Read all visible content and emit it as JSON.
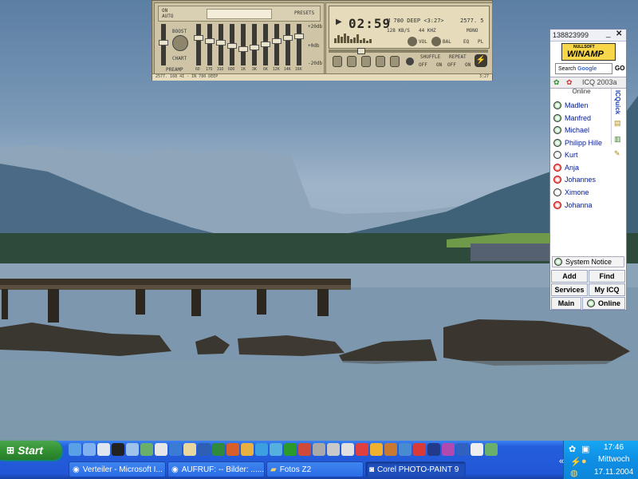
{
  "winamp": {
    "eq_labels": [
      "ON",
      "AUTO",
      "PRESETS",
      "PREAMP",
      "BOOST",
      "CHART",
      "60",
      "170",
      "310",
      "600",
      "1K",
      "3K",
      "6K",
      "12K",
      "14K",
      "16K",
      "+20db",
      "+0db",
      "-20db"
    ],
    "time": "02:59",
    "track": "M 780 DEEP <3:27>",
    "kbps": "128 KB/S",
    "khz": "44 KHZ",
    "mode": "MONO",
    "counter": "2577. 5",
    "vol_label": "VOL",
    "bal_label": "BAL",
    "eq_btn": "EQ",
    "pl_btn": "PL",
    "shuffle_label": "SHUFFLE",
    "repeat_label": "REPEAT",
    "off_label": "OFF",
    "on_label": "ON",
    "status_left": "2577. 168 4I - IN 780 DEEP",
    "status_right": "3:27"
  },
  "icq": {
    "uin": "138823999",
    "ad_text": "WINAMP",
    "ad_sub": "NULLSOFT",
    "search_label": "Search",
    "search_brand": "Google",
    "go_label": "GO",
    "version": "ICQ 2003a",
    "section": "Online",
    "side_tab": "ICQuick",
    "contacts": [
      {
        "name": "Madlen",
        "status": "online"
      },
      {
        "name": "Manfred",
        "status": "online"
      },
      {
        "name": "Michael",
        "status": "online"
      },
      {
        "name": "Philipp Hille",
        "status": "online"
      },
      {
        "name": "Kurt",
        "status": "away"
      },
      {
        "name": "Anja",
        "status": "offline"
      },
      {
        "name": "Johannes",
        "status": "offline"
      },
      {
        "name": "Ximone",
        "status": "away"
      },
      {
        "name": "Johanna",
        "status": "offline"
      }
    ],
    "system_notice": "System Notice",
    "buttons": {
      "add": "Add",
      "find": "Find",
      "services": "Services",
      "myicq": "My ICQ",
      "main": "Main",
      "online": "Online"
    }
  },
  "taskbar": {
    "start": "Start",
    "tasks": [
      {
        "label": "Verteiler - Microsoft I...",
        "active": false
      },
      {
        "label": "AUFRUF: -- Bilder: ......",
        "active": false
      },
      {
        "label": "Fotos Z2",
        "active": false
      },
      {
        "label": "Corel PHOTO-PAINT 9",
        "active": true
      }
    ],
    "clock": {
      "time": "17:46",
      "day": "Mittwoch",
      "date": "17.11.2004"
    }
  }
}
